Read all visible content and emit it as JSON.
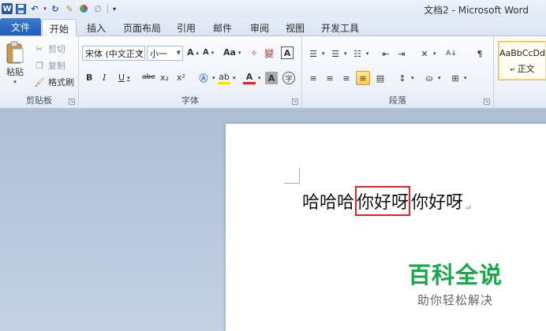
{
  "window": {
    "title": "文档2 - Microsoft Word"
  },
  "qat": {
    "logo": "W"
  },
  "tabs": [
    {
      "label": "文件"
    },
    {
      "label": "开始"
    },
    {
      "label": "插入"
    },
    {
      "label": "页面布局"
    },
    {
      "label": "引用"
    },
    {
      "label": "邮件"
    },
    {
      "label": "审阅"
    },
    {
      "label": "视图"
    },
    {
      "label": "开发工具"
    }
  ],
  "clipboard": {
    "paste_label": "粘贴",
    "cut_label": "剪切",
    "copy_label": "复制",
    "format_painter_label": "格式刷",
    "group_label": "剪贴板"
  },
  "font": {
    "font_name": "宋体 (中文正文",
    "font_size": "小一",
    "grow_label": "A",
    "shrink_label": "A",
    "case_label": "Aa",
    "bold": "B",
    "italic": "I",
    "underline": "U",
    "strike": "abe",
    "subscript": "x₂",
    "superscript": "x²",
    "group_label": "字体"
  },
  "paragraph": {
    "group_label": "段落"
  },
  "styles": {
    "preview": "AaBbCcDd",
    "name": "正文"
  },
  "document": {
    "prefix": "哈哈哈",
    "selected": "你好呀",
    "suffix": "你好呀",
    "para_mark": "↵"
  },
  "watermark": {
    "title": "百科全说",
    "subtitle": "助你轻松解决"
  },
  "colors": {
    "file_tab": "#1f5db7",
    "highlight_border": "#e0242c",
    "watermark_green": "#19a94a",
    "active_button": "#f8c94c"
  }
}
